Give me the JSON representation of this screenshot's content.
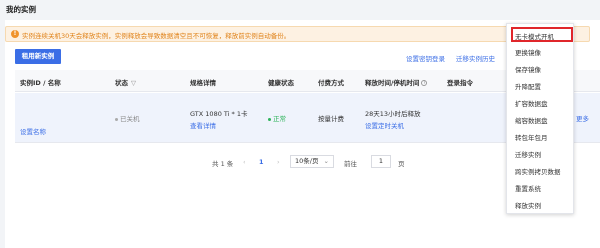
{
  "page": {
    "title": "我的实例"
  },
  "warning": {
    "text": "实例连续关机30天会释放实例，实例释放会导致数据清空且不可恢复，释放前实例自动备份。"
  },
  "toolbar": {
    "new_instance_label": "租用新实例",
    "set_password_label": "设置密钥登录",
    "migration_history_label": "迁移实例历史"
  },
  "table": {
    "columns": [
      "实例ID / 名称",
      "状态",
      "规格详情",
      "健康状态",
      "付费方式",
      "释放时间/停机时间",
      "登录指令"
    ],
    "rows": [
      {
        "name_link": "设置名称",
        "status": "已关机",
        "spec": "GTX 1080 Ti * 1卡",
        "spec_link": "查看详情",
        "health": "正常",
        "billing": "按量计费",
        "release_time": "28天13小时后释放",
        "release_link": "设置定时关机",
        "more": "更多"
      }
    ]
  },
  "pagination": {
    "total": "共 1 条",
    "prev": "‹",
    "current_page": "1",
    "next": "›",
    "page_size": "10条/页",
    "goto_label": "前往",
    "goto_value": "1",
    "page_suffix": "页"
  },
  "dropdown": {
    "items": [
      "无卡模式开机",
      "更换镜像",
      "保存镜像",
      "升降配置",
      "扩容数据盘",
      "缩容数据盘",
      "转包年包月",
      "迁移实例",
      "跨实例拷贝数据",
      "重置系统",
      "释放实例"
    ]
  },
  "colors": {
    "accent": "#3b6ee6",
    "warning": "#e0831a",
    "healthy": "#2db35a",
    "highlight_border": "#e0262b"
  }
}
